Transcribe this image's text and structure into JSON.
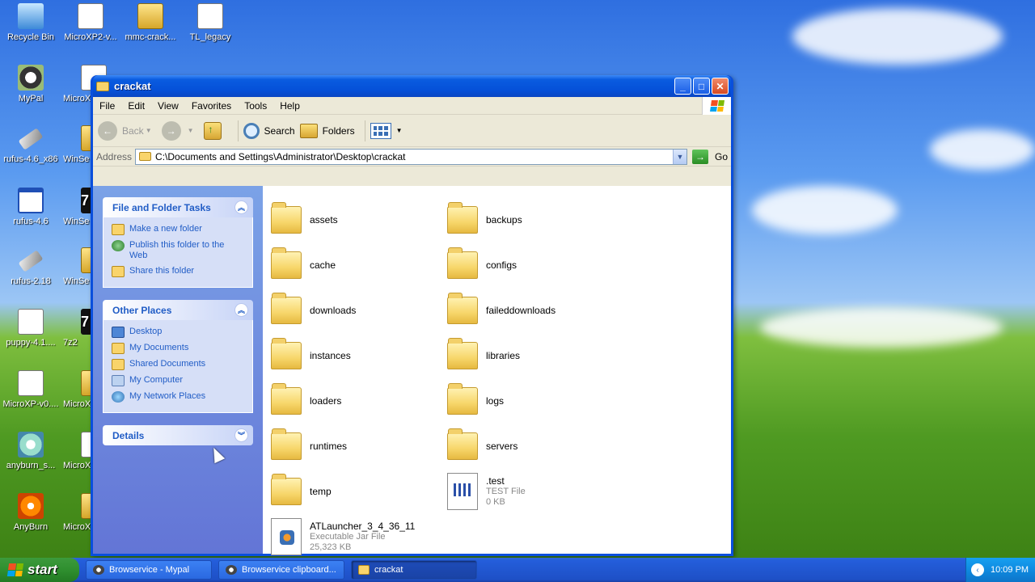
{
  "desktop": {
    "icons": [
      {
        "label": "Recycle Bin",
        "icon": "recycle-bin-icon"
      },
      {
        "label": "MicroXP2-v...",
        "icon": "file-icon"
      },
      {
        "label": "mmc-crack...",
        "icon": "zip-folder-icon"
      },
      {
        "label": "TL_legacy",
        "icon": "file-icon"
      },
      {
        "label": "MyPal",
        "icon": "mypal-icon"
      },
      {
        "label": "MicroX",
        "icon": "file-icon"
      },
      {
        "label": "rufus-4.6_x86",
        "icon": "usb-icon"
      },
      {
        "label": "WinSe",
        "icon": "zip-folder-icon"
      },
      {
        "label": "rufus-4.6",
        "icon": "window-icon"
      },
      {
        "label": "WinSe",
        "icon": "7zip-icon"
      },
      {
        "label": "rufus-2.18",
        "icon": "usb-icon"
      },
      {
        "label": "WinSe",
        "icon": "zip-folder-icon"
      },
      {
        "label": "puppy-4.1....",
        "icon": "file-icon"
      },
      {
        "label": "7z2",
        "icon": "7zip-icon"
      },
      {
        "label": "MicroXP-v0....",
        "icon": "file-icon"
      },
      {
        "label": "MicroX",
        "icon": "zip-folder-icon"
      },
      {
        "label": "anyburn_s...",
        "icon": "disc-icon"
      },
      {
        "label": "MicroX",
        "icon": "file-icon"
      },
      {
        "label": "AnyBurn",
        "icon": "anyburn-icon"
      },
      {
        "label": "MicroX",
        "icon": "zip-folder-icon"
      }
    ]
  },
  "window": {
    "title": "crackat",
    "menu": [
      "File",
      "Edit",
      "View",
      "Favorites",
      "Tools",
      "Help"
    ],
    "toolbar": {
      "back": "Back",
      "search": "Search",
      "folders": "Folders"
    },
    "address": {
      "label": "Address",
      "value": "C:\\Documents and Settings\\Administrator\\Desktop\\crackat",
      "go": "Go"
    },
    "taskpane": {
      "file_tasks": {
        "title": "File and Folder Tasks",
        "items": [
          "Make a new folder",
          "Publish this folder to the Web",
          "Share this folder"
        ]
      },
      "other_places": {
        "title": "Other Places",
        "items": [
          "Desktop",
          "My Documents",
          "Shared Documents",
          "My Computer",
          "My Network Places"
        ]
      },
      "details": {
        "title": "Details"
      }
    },
    "files": [
      {
        "name": "assets",
        "type": "folder"
      },
      {
        "name": "backups",
        "type": "folder"
      },
      {
        "name": "cache",
        "type": "folder"
      },
      {
        "name": "configs",
        "type": "folder"
      },
      {
        "name": "downloads",
        "type": "folder"
      },
      {
        "name": "faileddownloads",
        "type": "folder"
      },
      {
        "name": "instances",
        "type": "folder"
      },
      {
        "name": "libraries",
        "type": "folder"
      },
      {
        "name": "loaders",
        "type": "folder"
      },
      {
        "name": "logs",
        "type": "folder"
      },
      {
        "name": "runtimes",
        "type": "folder"
      },
      {
        "name": "servers",
        "type": "folder"
      },
      {
        "name": "temp",
        "type": "folder"
      },
      {
        "name": ".test",
        "type": "file",
        "kind": "TEST File",
        "size": "0 KB"
      },
      {
        "name": "ATLauncher_3_4_36_11",
        "type": "jar",
        "kind": "Executable Jar File",
        "size": "25,323 KB"
      }
    ]
  },
  "taskbar": {
    "start": "start",
    "buttons": [
      {
        "label": "Browservice - Mypal",
        "active": false
      },
      {
        "label": "Browservice clipboard...",
        "active": false
      },
      {
        "label": "crackat",
        "active": true
      }
    ],
    "clock": "10:09 PM"
  },
  "colors": {
    "xp_blue": "#0a4fdc",
    "task_link": "#215dc6",
    "start_green": "#2f8f2f"
  }
}
